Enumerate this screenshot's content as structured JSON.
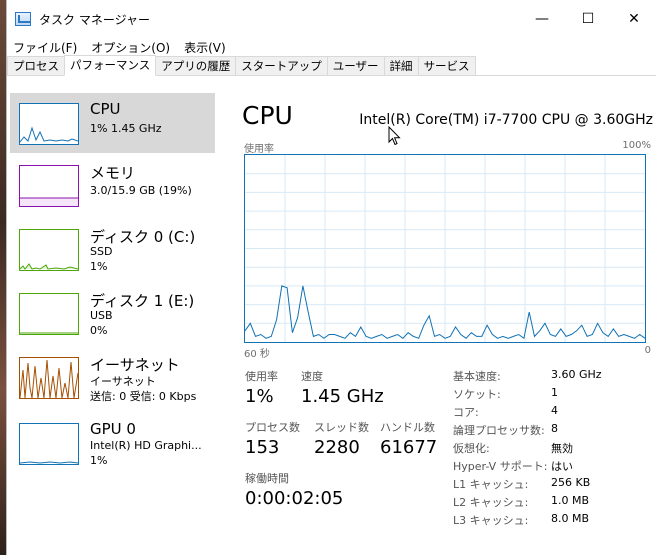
{
  "window": {
    "title": "タスク マネージャー",
    "minimize": "—",
    "maximize": "☐",
    "close": "✕"
  },
  "menu": [
    "ファイル(F)",
    "オプション(O)",
    "表示(V)"
  ],
  "tabs": [
    "プロセス",
    "パフォーマンス",
    "アプリの履歴",
    "スタートアップ",
    "ユーザー",
    "詳細",
    "サービス"
  ],
  "active_tab": "パフォーマンス",
  "sidebar": [
    {
      "title": "CPU",
      "sub1": "1% 1.45 GHz",
      "sub2": "",
      "color": "#1172b4"
    },
    {
      "title": "メモリ",
      "sub1": "3.0/15.9 GB (19%)",
      "sub2": "",
      "color": "#8b12ae"
    },
    {
      "title": "ディスク 0 (C:)",
      "sub1": "SSD",
      "sub2": "1%",
      "color": "#4da60c"
    },
    {
      "title": "ディスク 1 (E:)",
      "sub1": "USB",
      "sub2": "0%",
      "color": "#4da60c"
    },
    {
      "title": "イーサネット",
      "sub1": "イーサネット",
      "sub2": "送信: 0 受信: 0 Kbps",
      "color": "#a74f01"
    },
    {
      "title": "GPU 0",
      "sub1": "Intel(R) HD Graphi...",
      "sub2": "1%",
      "color": "#1172b4"
    }
  ],
  "main": {
    "title": "CPU",
    "cpu_name": "Intel(R) Core(TM) i7-7700 CPU @ 3.60GHz",
    "graph_label": "使用率",
    "graph_max": "100%",
    "axis_left": "60 秒",
    "axis_right": "0",
    "usage_label": "使用率",
    "usage_value": "1%",
    "speed_label": "速度",
    "speed_value": "1.45 GHz",
    "proc_label": "プロセス数",
    "proc_value": "153",
    "thread_label": "スレッド数",
    "thread_value": "2280",
    "handle_label": "ハンドル数",
    "handle_value": "61677",
    "uptime_label": "稼働時間",
    "uptime_value": "0:00:02:05",
    "details": [
      {
        "key": "基本速度:",
        "value": "3.60 GHz"
      },
      {
        "key": "ソケット:",
        "value": "1"
      },
      {
        "key": "コア:",
        "value": "4"
      },
      {
        "key": "論理プロセッサ数:",
        "value": "8"
      },
      {
        "key": "仮想化:",
        "value": "無効"
      },
      {
        "key": "Hyper-V サポート:",
        "value": "はい"
      },
      {
        "key": "L1 キャッシュ:",
        "value": "256 KB"
      },
      {
        "key": "L2 キャッシュ:",
        "value": "1.0 MB"
      },
      {
        "key": "L3 キャッシュ:",
        "value": "8.0 MB"
      }
    ]
  },
  "colors": {
    "cpu_line": "#1172b4",
    "grid": "#d9eaf7",
    "selected": "#d8d8d8"
  },
  "chart_data": {
    "type": "line",
    "title": "",
    "xlabel": "",
    "ylabel": "",
    "ylim": [
      0,
      100
    ],
    "x_range_seconds": [
      60,
      0
    ],
    "series": [
      {
        "values": [
          6,
          10,
          3,
          4,
          2,
          3,
          12,
          30,
          29,
          5,
          13,
          30,
          16,
          3,
          4,
          2,
          4,
          4,
          3,
          2,
          5,
          3,
          8,
          3,
          2,
          3,
          4,
          2,
          3,
          4,
          2,
          5,
          3,
          2,
          9,
          14,
          3,
          4,
          2,
          3,
          8,
          4,
          2,
          5,
          3,
          3,
          9,
          4,
          2,
          3,
          2,
          3,
          4,
          2,
          16,
          3,
          6,
          10,
          4,
          3,
          7,
          3,
          4,
          6,
          9,
          3,
          4,
          10,
          5,
          3,
          7,
          3,
          4,
          3,
          2,
          4,
          2
        ]
      }
    ]
  }
}
